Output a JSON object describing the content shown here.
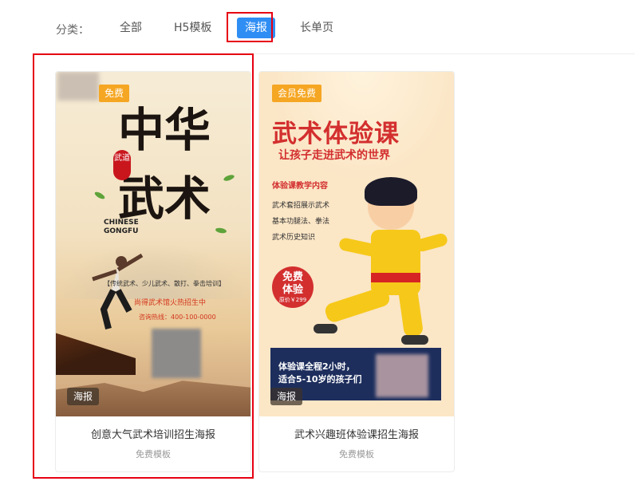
{
  "filter": {
    "label": "分类：",
    "tabs": [
      {
        "label": "全部"
      },
      {
        "label": "H5模板"
      },
      {
        "label": "海报"
      },
      {
        "label": "长单页"
      }
    ],
    "active_tab": "海报"
  },
  "cards": [
    {
      "badge": "免费",
      "poster": {
        "cal_top": "中华",
        "cal_bottom": "武术",
        "seal": "武道",
        "eng": [
          "CHINESE",
          "GONGFU"
        ],
        "line1": "【传统武术、少儿武术、散打、拳击培训】",
        "line2": "尚得武术馆火热招生中",
        "line3": "咨询热线：400-100-0000"
      },
      "tag": "海报",
      "title": "创意大气武术培训招生海报",
      "subtitle": "免费模板"
    },
    {
      "badge": "会员免费",
      "poster": {
        "title": "武术体验课",
        "sub": "让孩子走进武术的世界",
        "section": "体验课教学内容",
        "items": [
          "武术套招展示武术",
          "基本功腿法、拳法",
          "武术历史知识"
        ],
        "circle_main": "免费",
        "circle_main2": "体验",
        "circle_price": "原价￥299",
        "banner1": "体验课全程2小时，",
        "banner2": "适合5-10岁的孩子们"
      },
      "tag": "海报",
      "title": "武术兴趣班体验课招生海报",
      "subtitle": "免费模板"
    }
  ],
  "colors": {
    "active_tab": "#2f8ef4",
    "badge": "#f5a623",
    "highlight": "#e60012",
    "poster_red": "#d32f2f"
  }
}
